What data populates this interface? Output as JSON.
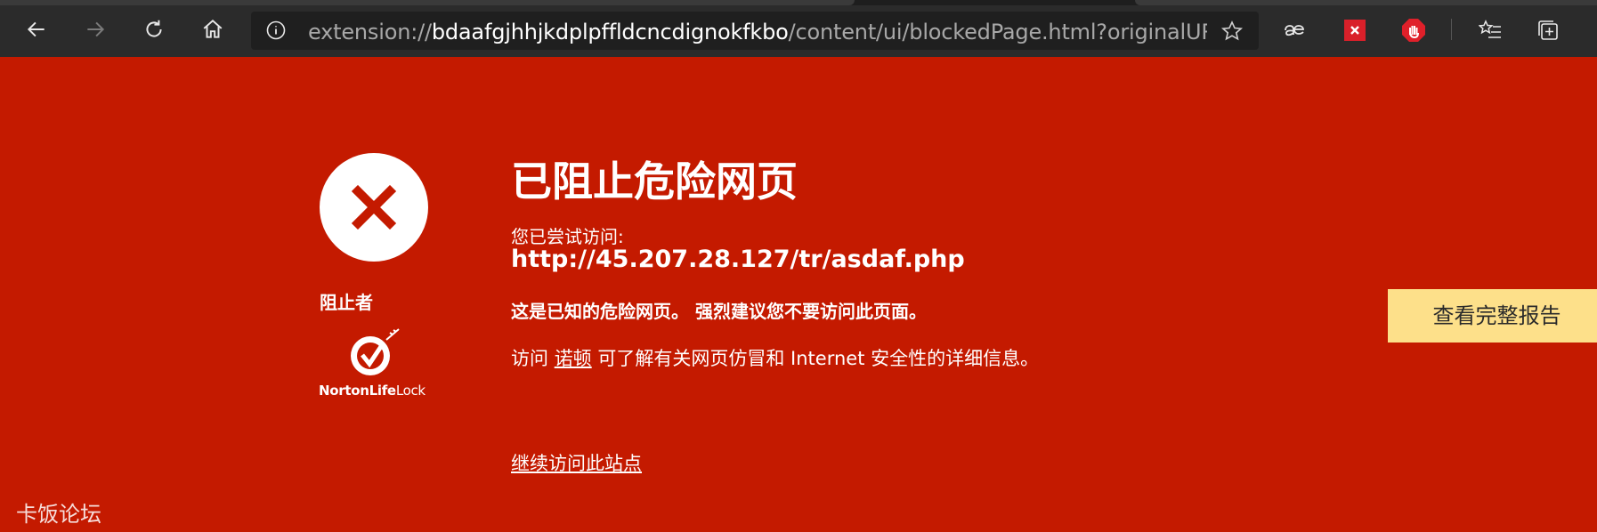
{
  "browser": {
    "url_scheme": "extension://",
    "url_host": "bdaafgjhhjkdplpffldcncdignokfkbo",
    "url_rest": "/content/ui/blockedPage.html?originalURL=ht..."
  },
  "page": {
    "title": "已阻止危险网页",
    "tried_label": "您已尝试访问:",
    "blocked_url": "http://45.207.28.127/tr/asdaf.php",
    "warning": "这是已知的危险网页。 强烈建议您不要访问此页面。",
    "info_prefix": "访问 ",
    "info_link": "诺顿",
    "info_suffix": " 可了解有关网页仿冒和 Internet 安全性的详细信息。",
    "continue_link": "继续访问此站点",
    "report_button": "查看完整报告",
    "blocked_by_label": "阻止者",
    "brand_name_bold": "NortonLife",
    "brand_name_light": "Lock",
    "watermark": "卡饭论坛"
  },
  "colors": {
    "page_background": "#c41a00",
    "report_button_bg": "#fde08a",
    "toolbar_bg": "#2b2b2b"
  }
}
